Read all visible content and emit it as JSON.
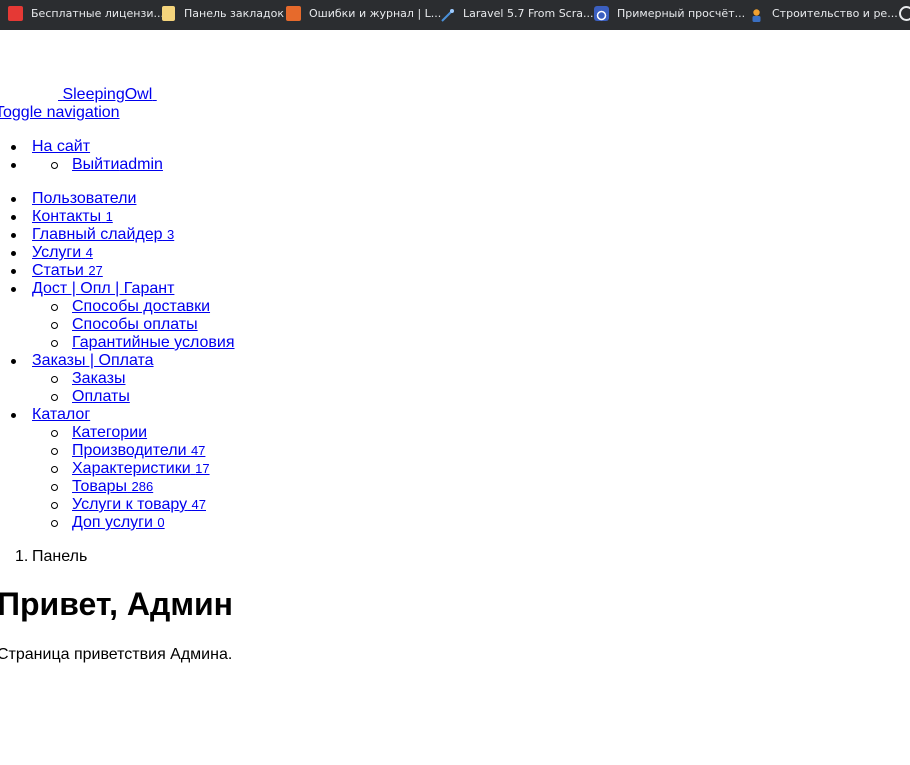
{
  "bookmarks": [
    {
      "label": "Бесплатные лицензи...",
      "icon": "red-square-icon",
      "color": "#e53935"
    },
    {
      "label": "Панель закладок",
      "icon": "folder-icon",
      "color": "#f4d47c"
    },
    {
      "label": "Ошибки и журнал | L...",
      "icon": "orange-site-icon",
      "color": "#e66a2c"
    },
    {
      "label": "Laravel 5.7 From Scra...",
      "icon": "wand-icon",
      "color": "#4a90d9"
    },
    {
      "label": "Примерный просчёт...",
      "icon": "blue-circle-icon",
      "color": "#3b5fc0"
    },
    {
      "label": "Строительство и ре...",
      "icon": "worker-icon",
      "color": "#f0a030"
    }
  ],
  "brand": {
    "label": "SleepingOwl"
  },
  "toggle_label": "Toggle navigation",
  "top_nav": {
    "site_link": "На сайт",
    "logout_link": "Выйти",
    "user": "admin"
  },
  "menu": {
    "users": "Пользователи",
    "contacts": {
      "label": "Контакты",
      "count": "1"
    },
    "slider": {
      "label": "Главный слайдер",
      "count": "3"
    },
    "services": {
      "label": "Услуги",
      "count": "4"
    },
    "articles": {
      "label": "Статьи",
      "count": "27"
    },
    "delivery_group": {
      "label": "Дост | Опл | Гарант",
      "items": [
        "Способы доставки",
        "Способы оплаты",
        "Гарантийные условия"
      ]
    },
    "orders_group": {
      "label": "Заказы | Оплата",
      "items": [
        "Заказы",
        "Оплаты"
      ]
    },
    "catalog_group": {
      "label": "Каталог",
      "categories": "Категории",
      "manufacturers": {
        "label": "Производители",
        "count": "47"
      },
      "characteristics": {
        "label": "Характеристики",
        "count": "17"
      },
      "products": {
        "label": "Товары",
        "count": "286"
      },
      "product_services": {
        "label": "Услуги к товару",
        "count": "47"
      },
      "extra_services": {
        "label": "Доп услуги",
        "count": "0"
      }
    }
  },
  "breadcrumb": {
    "number": "1.",
    "label": "Панель"
  },
  "page": {
    "title": "Привет, Админ",
    "text": "Страница приветствия Админа."
  }
}
